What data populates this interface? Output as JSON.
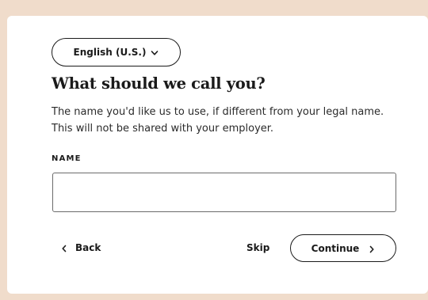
{
  "language_selector": {
    "label": "English (U.S.)",
    "icon": "chevron-down-icon"
  },
  "heading": "What should we call you?",
  "description": "The name you'd like us to use, if different from your legal name. This will not be shared with your employer.",
  "name_field": {
    "label": "NAME",
    "value": "",
    "placeholder": ""
  },
  "actions": {
    "back_label": "Back",
    "back_icon": "chevron-left-icon",
    "skip_label": "Skip",
    "continue_label": "Continue",
    "continue_icon": "chevron-right-icon"
  },
  "colors": {
    "page_background": "#f0dccb",
    "card_background": "#ffffff",
    "text": "#1a1a1a"
  }
}
